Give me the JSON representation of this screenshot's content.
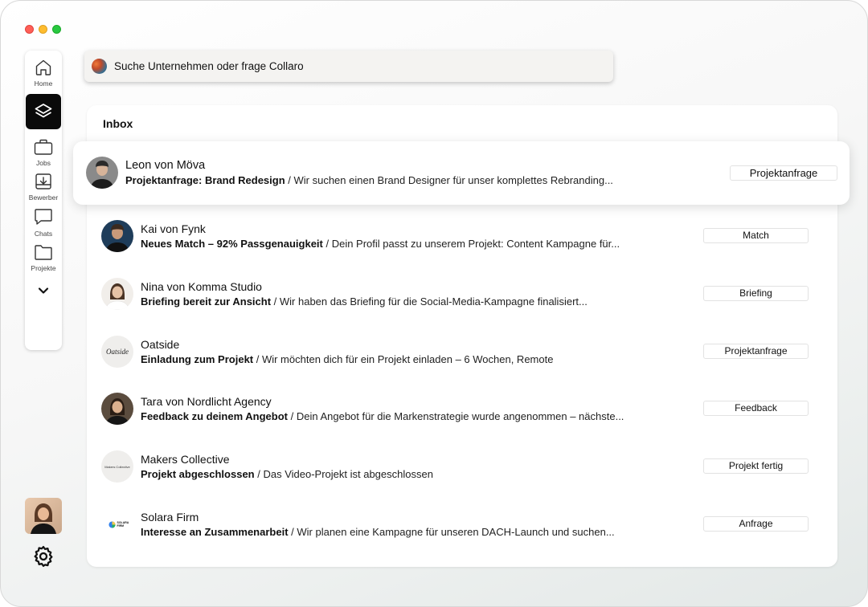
{
  "search": {
    "placeholder": "Suche Unternehmen oder frage Collaro"
  },
  "sidebar": {
    "items": [
      {
        "label": "Home",
        "icon": "home-icon"
      },
      {
        "label": "",
        "icon": "layers-icon",
        "active": true
      },
      {
        "label": "Jobs",
        "icon": "briefcase-icon"
      },
      {
        "label": "Bewerber",
        "icon": "inbox-download-icon"
      },
      {
        "label": "Chats",
        "icon": "chat-bubble-icon"
      },
      {
        "label": "Projekte",
        "icon": "folder-icon"
      }
    ],
    "more_icon": "chevron-down-icon",
    "settings_icon": "gear-icon"
  },
  "inbox": {
    "title": "Inbox",
    "items": [
      {
        "name": "Leon von Möva",
        "subject": "Projektanfrage: Brand Redesign",
        "preview": " / Wir suchen einen Brand Designer für unser komplettes Rebranding...",
        "tag": "Projektanfrage",
        "highlighted": true
      },
      {
        "name": "Kai von Fynk",
        "subject": "Neues Match – 92% Passgenauigkeit",
        "preview": " / Dein Profil passt zu unserem Projekt: Content Kampagne für...",
        "tag": "Match"
      },
      {
        "name": "Nina von Komma Studio",
        "subject": "Briefing bereit zur Ansicht",
        "preview": " / Wir haben das Briefing für die Social-Media-Kampagne finalisiert...",
        "tag": "Briefing"
      },
      {
        "name": "Oatside",
        "subject": "Einladung zum Projekt",
        "preview": " / Wir möchten dich für ein Projekt einladen – 6 Wochen, Remote",
        "tag": "Projektanfrage",
        "logo_text": "Oatside"
      },
      {
        "name": "Tara von Nordlicht Agency",
        "subject": "Feedback zu deinem Angebot",
        "preview": " / Dein Angebot für die Markenstrategie wurde angenommen – nächste...",
        "tag": "Feedback"
      },
      {
        "name": "Makers Collective",
        "subject": "Projekt abgeschlossen",
        "preview": " / Das Video-Projekt ist abgeschlossen",
        "tag": "Projekt fertig",
        "logo_text": "Makers Collective"
      },
      {
        "name": "Solara Firm",
        "subject": "Interesse an Zusammenarbeit",
        "preview": " / Wir planen eine Kampagne für unseren DACH-Launch und suchen...",
        "tag": "Anfrage",
        "logo_text": "SOLARA FIRM"
      }
    ]
  }
}
